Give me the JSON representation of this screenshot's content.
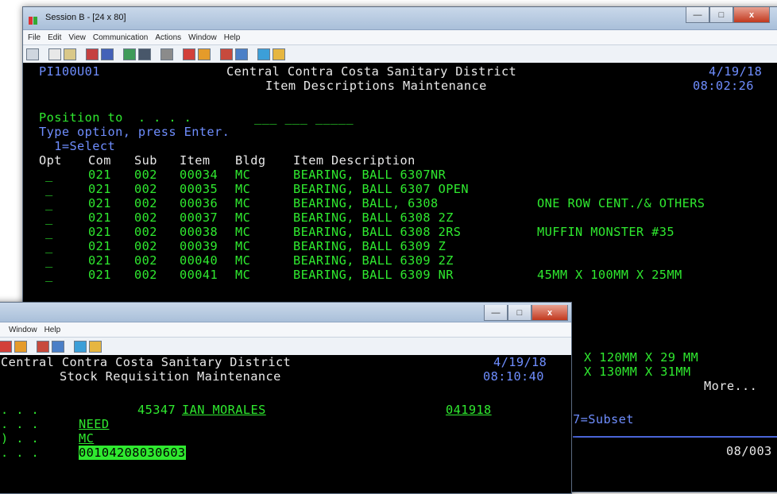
{
  "window_a": {
    "title": "Session B - [24 x 80]",
    "menu": [
      "File",
      "Edit",
      "View",
      "Communication",
      "Actions",
      "Window",
      "Help"
    ],
    "screen": {
      "program_id": "PI100U01",
      "company": "Central Contra Costa Sanitary District",
      "date": "4/19/18",
      "subtitle": "Item Descriptions Maintenance",
      "time": "08:02:26",
      "position_to": "Position to  . . . .",
      "position_fields": "___ ___ _____",
      "instruction": "Type option, press Enter.",
      "option_legend": "  1=Select",
      "headers": [
        "Opt",
        "Com",
        "Sub",
        "Item",
        "Bldg",
        "Item Description"
      ],
      "rows": [
        {
          "opt": "_",
          "com": "021",
          "sub": "002",
          "item": "00034",
          "bldg": "MC",
          "desc": "BEARING, BALL 6307NR",
          "note": ""
        },
        {
          "opt": "_",
          "com": "021",
          "sub": "002",
          "item": "00035",
          "bldg": "MC",
          "desc": "BEARING, BALL 6307 OPEN",
          "note": ""
        },
        {
          "opt": "_",
          "com": "021",
          "sub": "002",
          "item": "00036",
          "bldg": "MC",
          "desc": "BEARING, BALL, 6308",
          "note": "ONE ROW CENT./& OTHERS"
        },
        {
          "opt": "_",
          "com": "021",
          "sub": "002",
          "item": "00037",
          "bldg": "MC",
          "desc": "BEARING, BALL 6308 2Z",
          "note": ""
        },
        {
          "opt": "_",
          "com": "021",
          "sub": "002",
          "item": "00038",
          "bldg": "MC",
          "desc": "BEARING, BALL 6308 2RS",
          "note": "MUFFIN MONSTER #35"
        },
        {
          "opt": "_",
          "com": "021",
          "sub": "002",
          "item": "00039",
          "bldg": "MC",
          "desc": "BEARING, BALL 6309 Z",
          "note": ""
        },
        {
          "opt": "_",
          "com": "021",
          "sub": "002",
          "item": "00040",
          "bldg": "MC",
          "desc": "BEARING, BALL 6309 2Z",
          "note": ""
        },
        {
          "opt": "_",
          "com": "021",
          "sub": "002",
          "item": "00041",
          "bldg": "MC",
          "desc": "BEARING, BALL 6309 NR",
          "note": "45MM X 100MM X 25MM"
        }
      ],
      "partial_note_1": "X 120MM X 29 MM",
      "partial_note_2": "X 130MM X 31MM",
      "more": "More...",
      "subset": "7=Subset",
      "cursor_pos": "08/003"
    }
  },
  "window_b": {
    "menu": [
      "Window",
      "Help"
    ],
    "screen": {
      "company": "Central Contra Costa Sanitary District",
      "date": "4/19/18",
      "subtitle": "Stock Requisition Maintenance",
      "time": "08:10:40",
      "dots_1": ". . .",
      "req_no": "45347",
      "requester": "IAN MORALES",
      "req_date": "041918",
      "dots_2": ". . .",
      "field_need": "NEED",
      "dots_3": ") . .",
      "field_bldg": "MC",
      "dots_4": ". . .",
      "field_account": "00104208030603"
    }
  },
  "colors": {
    "terminal_bg": "#000000",
    "terminal_green": "#2fe92f",
    "terminal_blue": "#6f8eff",
    "terminal_white": "#e8e8e8"
  }
}
